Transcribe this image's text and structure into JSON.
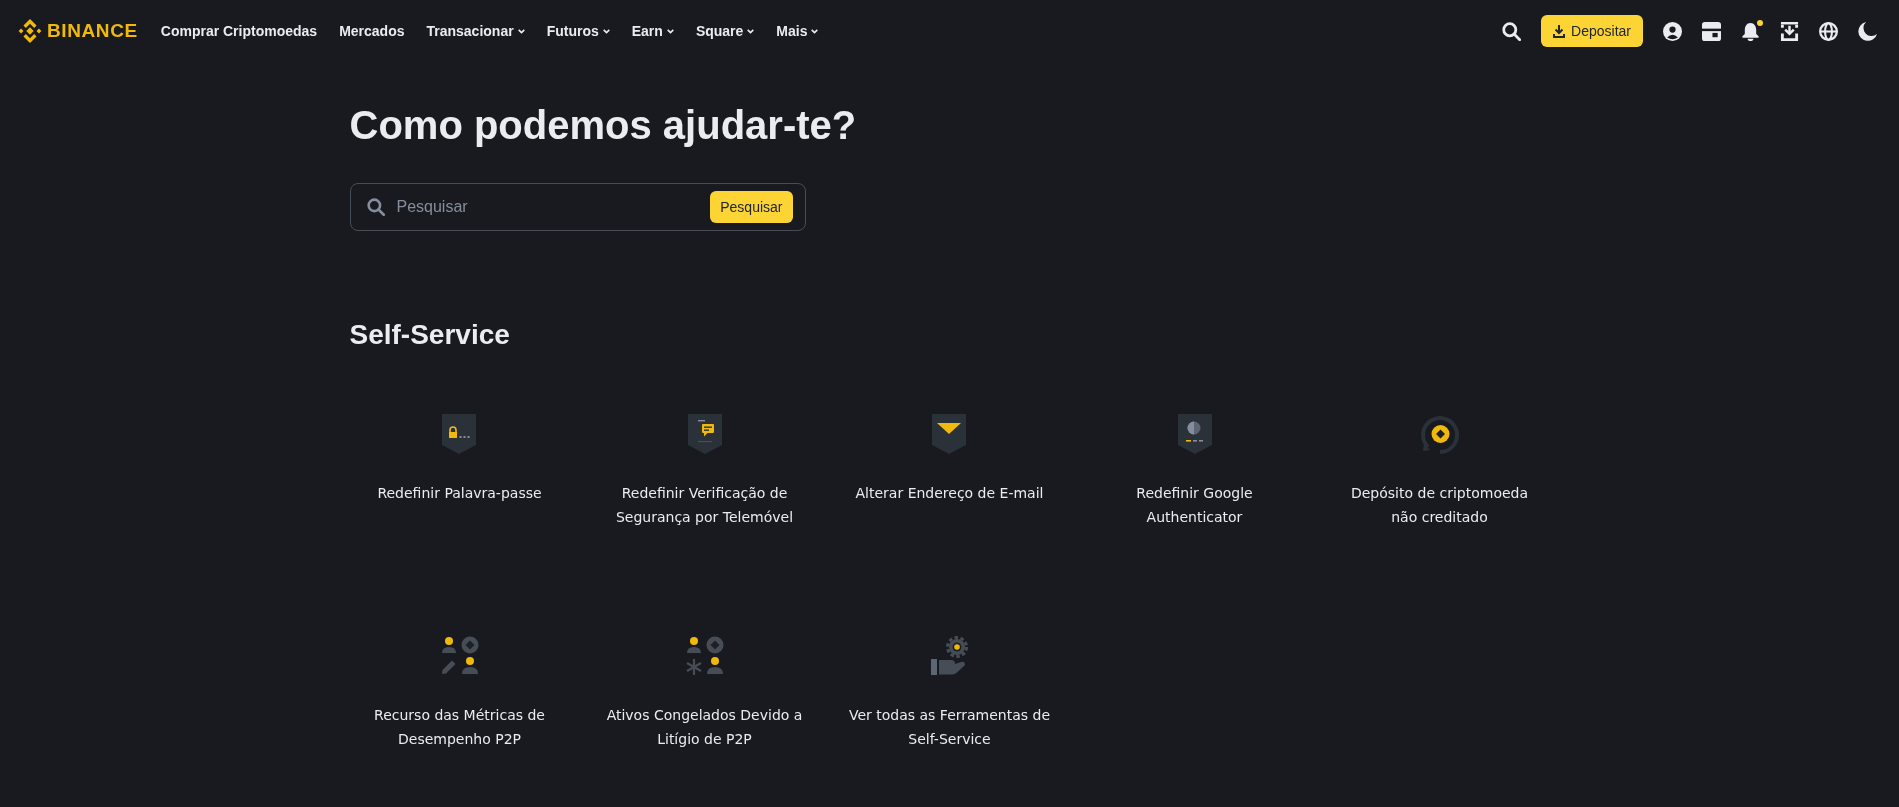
{
  "header": {
    "logo": "BINANCE",
    "nav": [
      {
        "label": "Comprar Criptomoedas",
        "has_menu": false
      },
      {
        "label": "Mercados",
        "has_menu": false
      },
      {
        "label": "Transacionar",
        "has_menu": true
      },
      {
        "label": "Futuros",
        "has_menu": true
      },
      {
        "label": "Earn",
        "has_menu": true
      },
      {
        "label": "Square",
        "has_menu": true
      },
      {
        "label": "Mais",
        "has_menu": true
      }
    ],
    "deposit_button": "Depositar",
    "notifications": {
      "unread": true
    }
  },
  "hero": {
    "title": "Como podemos ajudar-te?",
    "search": {
      "placeholder": "Pesquisar",
      "button": "Pesquisar"
    }
  },
  "self_service": {
    "title": "Self-Service",
    "items": [
      {
        "label": "Redefinir Palavra-passe",
        "kind": "password"
      },
      {
        "label": "Redefinir Verificação de Segurança por Telemóvel",
        "kind": "phone"
      },
      {
        "label": "Alterar Endereço de E-mail",
        "kind": "email"
      },
      {
        "label": "Redefinir Google Authenticator",
        "kind": "authenticator"
      },
      {
        "label": "Depósito de criptomoeda não creditado",
        "kind": "deposit"
      },
      {
        "label": "Recurso das Métricas de Desempenho P2P",
        "kind": "appeal"
      },
      {
        "label": "Ativos Congelados Devido a Litígio de P2P",
        "kind": "frozen"
      },
      {
        "label": "Ver todas as Ferramentas de Self-Service",
        "kind": "tools"
      }
    ]
  }
}
